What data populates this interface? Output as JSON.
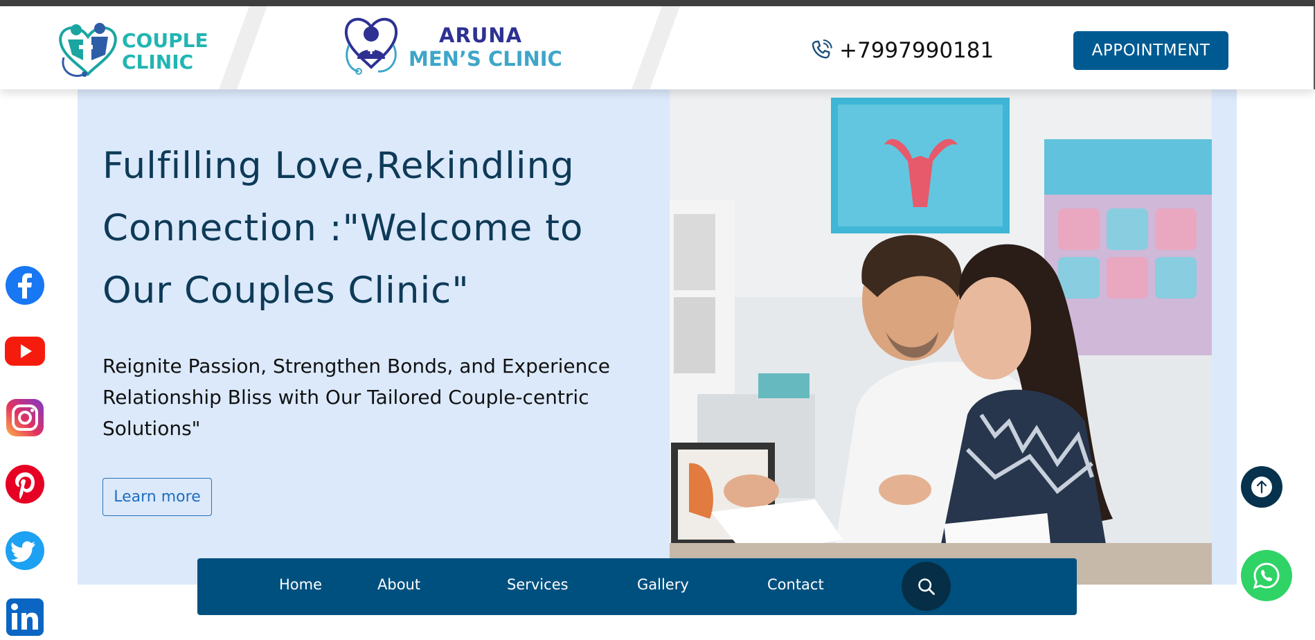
{
  "header": {
    "logo_left": {
      "line1": "COUPLE",
      "line2": "CLINIC"
    },
    "logo_center": {
      "line1": "ARUNA",
      "line2": "MEN’S CLINIC"
    },
    "phone": "+7997990181",
    "appointment_label": "APPOINTMENT"
  },
  "hero": {
    "title": "Fulfilling Love,Rekindling Connection :\"Welcome to Our Couples Clinic\"",
    "subtitle": "Reignite Passion, Strengthen Bonds, and Experience Relationship Bliss with Our Tailored Couple-centric Solutions\"",
    "cta_label": "Learn more"
  },
  "nav": {
    "items": [
      {
        "label": "Home"
      },
      {
        "label": "About"
      },
      {
        "label": "Services"
      },
      {
        "label": "Gallery"
      },
      {
        "label": "Contact"
      }
    ]
  },
  "social": [
    "facebook-icon",
    "youtube-icon",
    "instagram-icon",
    "pinterest-icon",
    "twitter-icon",
    "linkedin-icon"
  ],
  "colors": {
    "brand_blue": "#005a92",
    "nav_bg": "#00507f",
    "hero_bg": "#dbe9fb",
    "title_color": "#0e3a57",
    "whatsapp_green": "#2fd366"
  }
}
